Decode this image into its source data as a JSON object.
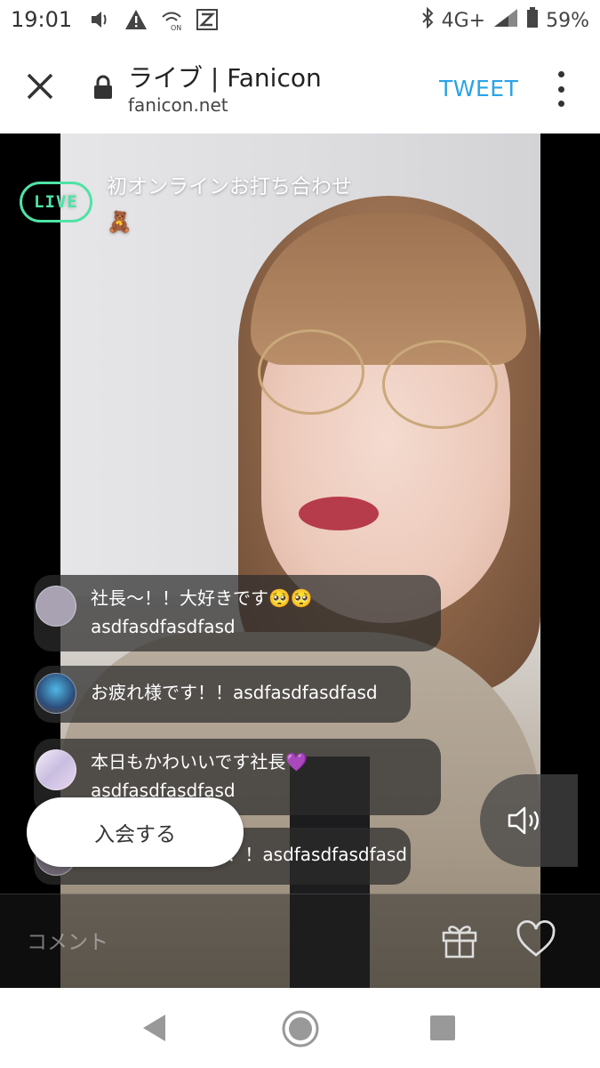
{
  "status_bar": {
    "time": "19:01",
    "network": "4G+",
    "battery": "59%",
    "icons_left": [
      "volume-icon",
      "warning-icon",
      "wifi-calling-icon",
      "app-z-icon"
    ],
    "icons_right": [
      "bluetooth-icon",
      "signal-icon",
      "battery-icon"
    ]
  },
  "browser": {
    "title": "ライブ | Fanicon",
    "url": "fanicon.net",
    "tweet_label": "TWEET"
  },
  "live": {
    "badge": "LIVE",
    "title": "初オンラインお打ち合わせ🧸"
  },
  "comments": [
    {
      "text": "社長〜！！大好きです🥺🥺asdfasdfasdfasd",
      "avatar_color": "#a9a2b3"
    },
    {
      "text": "お疲れ様です！！asdfasdfasdfasd",
      "avatar_color": "#3b6fa8"
    },
    {
      "text": "本日もかわいいです社長💜asdfasdfasdfasd",
      "avatar_color": "#d7cfe6"
    },
    {
      "text": "！！asdfasdfasdfasd",
      "avatar_color": "#6b6470"
    }
  ],
  "join_button": "入会する",
  "comment_input": {
    "placeholder": "コメント"
  },
  "colors": {
    "live_accent": "#4fe3a6",
    "tweet": "#2aa3e6"
  }
}
